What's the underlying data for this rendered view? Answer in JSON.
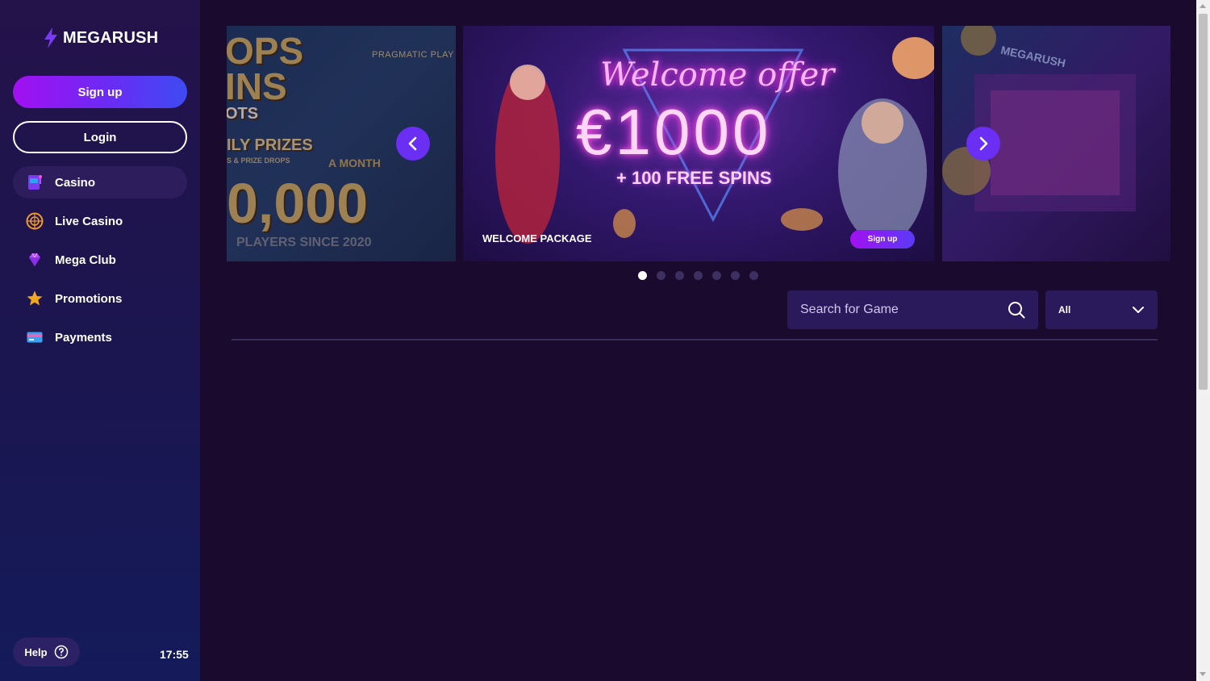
{
  "brand": {
    "name": "MEGARUSH"
  },
  "auth": {
    "signup_label": "Sign up",
    "login_label": "Login"
  },
  "nav": {
    "items": [
      {
        "label": "Casino",
        "icon": "slot-machine-icon",
        "active": true
      },
      {
        "label": "Live Casino",
        "icon": "roulette-icon"
      },
      {
        "label": "Mega Club",
        "icon": "diamond-icon"
      },
      {
        "label": "Promotions",
        "icon": "star-icon"
      },
      {
        "label": "Payments",
        "icon": "card-icon"
      }
    ]
  },
  "footer": {
    "help_label": "Help",
    "time": "17:55"
  },
  "carousel": {
    "left_slide": {
      "line1": "OPS",
      "line2": "INS",
      "line3": "OTS",
      "line4": "ILY PRIZES",
      "line5": "S & PRIZE DROPS",
      "line6": "A MONTH",
      "amount": "0,000",
      "footer": "PLAYERS SINCE 2020",
      "provider": "PRAGMATIC PLAY"
    },
    "center_slide": {
      "title": "Welcome offer",
      "amount": "€1000",
      "spins": "+ 100 FREE SPINS",
      "caption": "WELCOME PACKAGE",
      "cta": "Sign up"
    },
    "right_slide": {
      "brand": "MEGARUSH"
    },
    "dots_total": 7,
    "active_dot": 0
  },
  "search": {
    "placeholder": "Search for Game"
  },
  "filter": {
    "selected": "All"
  },
  "colors": {
    "background": "#1a0a2e",
    "accent": "#6a2ff2",
    "signup_gradient_start": "#a310f2",
    "signup_gradient_end": "#3d4bf2"
  }
}
